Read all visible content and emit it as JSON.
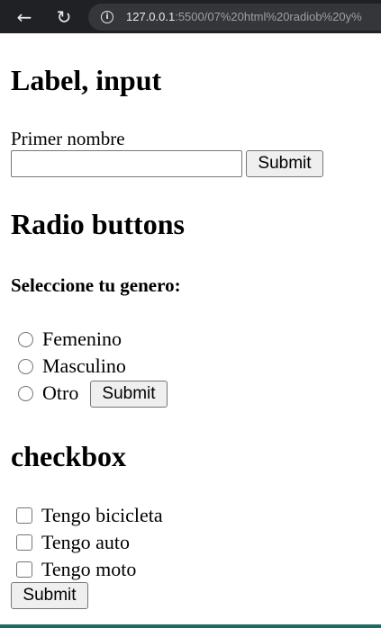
{
  "browser": {
    "back_glyph": "←",
    "reload_glyph": "↻",
    "info_glyph": "i",
    "url_host": "127.0.0.1",
    "url_path": ":5500/07%20html%20radiob%20y%"
  },
  "section_label": {
    "heading": "Label, input",
    "label": "Primer nombre",
    "input_value": "",
    "submit_label": "Submit"
  },
  "section_radio": {
    "heading": "Radio buttons",
    "question": "Seleccione tu genero:",
    "options": [
      "Femenino",
      "Masculino",
      "Otro"
    ],
    "selected": null,
    "submit_label": "Submit"
  },
  "section_checkbox": {
    "heading": "checkbox",
    "options": [
      "Tengo bicicleta",
      "Tengo auto",
      "Tengo moto"
    ],
    "checked": [],
    "submit_label": "Submit"
  },
  "colors": {
    "chrome_bg": "#202124",
    "address_bg": "#35363a",
    "bottom_strip": "#1e6b63"
  }
}
